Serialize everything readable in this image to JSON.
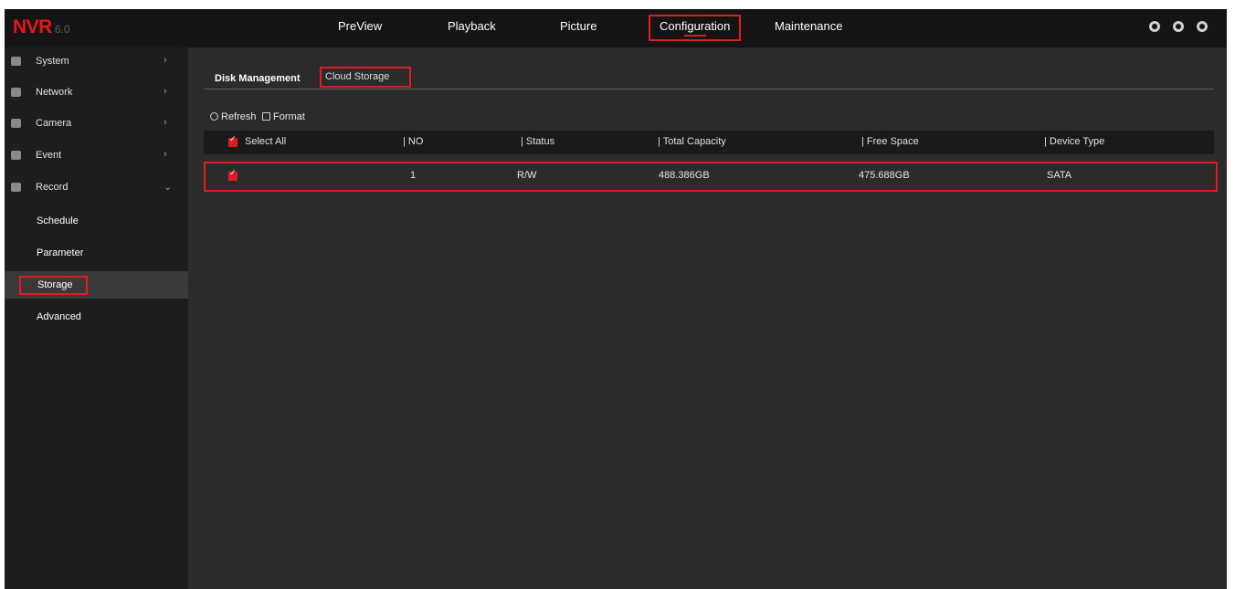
{
  "app": {
    "logo": "NVR",
    "version": "6.0"
  },
  "nav": {
    "items": [
      {
        "label": "PreView"
      },
      {
        "label": "Playback"
      },
      {
        "label": "Picture"
      },
      {
        "label": "Configuration"
      },
      {
        "label": "Maintenance"
      }
    ],
    "active": "Configuration",
    "icons": [
      "user-icon",
      "cloud-icon",
      "logout-icon"
    ]
  },
  "sidebar": {
    "items": [
      {
        "label": "System",
        "icon": "system-icon",
        "chevron": "›"
      },
      {
        "label": "Network",
        "icon": "network-icon",
        "chevron": "›"
      },
      {
        "label": "Camera",
        "icon": "camera-icon",
        "chevron": "›"
      },
      {
        "label": "Event",
        "icon": "event-icon",
        "chevron": "›"
      },
      {
        "label": "Record",
        "icon": "record-icon",
        "chevron": "⌄"
      }
    ],
    "sub_items": [
      {
        "label": "Schedule"
      },
      {
        "label": "Parameter"
      },
      {
        "label": "Storage"
      },
      {
        "label": "Advanced"
      }
    ],
    "active_sub": "Storage"
  },
  "tabs": {
    "items": [
      {
        "label": "Disk Management"
      },
      {
        "label": "Cloud Storage"
      }
    ]
  },
  "toolbar": {
    "refresh_label": "Refresh",
    "format_label": "Format"
  },
  "table": {
    "headers": {
      "select_all": "Select All",
      "no": "| NO",
      "status": "| Status",
      "total_capacity": "| Total Capacity",
      "free_space": "| Free Space",
      "device_type": "| Device Type"
    },
    "rows": [
      {
        "no": "1",
        "status": "R/W",
        "total_capacity": "488.386GB",
        "free_space": "475.688GB",
        "device_type": "SATA"
      }
    ]
  },
  "colors": {
    "accent": "#e01c22",
    "topbar": "#141414",
    "sidebar": "#1d1d1d",
    "content": "#2b2b2b"
  }
}
